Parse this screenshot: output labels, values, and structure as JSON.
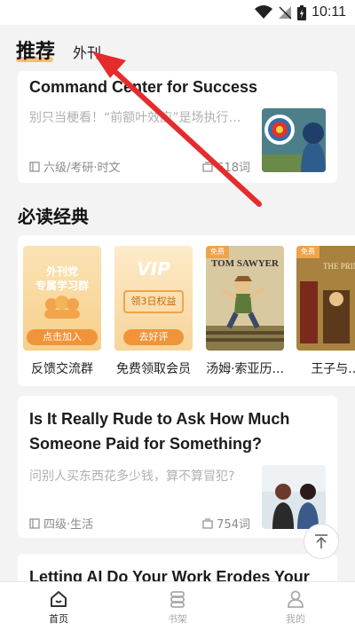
{
  "status_bar": {
    "time": "10:11"
  },
  "tabs": {
    "active": "推荐",
    "inactive": "外刊"
  },
  "article1": {
    "title": "Command Center for Success",
    "subtitle": "别只当梗看！“前额叶效应”是场执行…",
    "level": "六级/考研·时文",
    "words": "618词"
  },
  "section": {
    "title": "必读经典"
  },
  "classics": {
    "items": [
      {
        "label": "反馈交流群",
        "cover_line1": "外刊党",
        "cover_line2": "专属学习群",
        "cover_button": "点击加入"
      },
      {
        "label": "免费领取会员",
        "cover_vip": "VIP",
        "cover_line1": "领3日权益",
        "cover_button": "去好评"
      },
      {
        "label": "汤姆·索亚历...",
        "cover_title": "TOM SAWYER",
        "cover_tag": "免费"
      },
      {
        "label": "王子与...",
        "cover_title": "THE PRINCE",
        "cover_tag": "免费"
      }
    ]
  },
  "article2": {
    "title_line1": "Is It Really Rude to Ask How Much",
    "title_line2": "Someone Paid for Something?",
    "subtitle": "问别人买东西花多少钱，算不算冒犯?",
    "level": "四级·生活",
    "words": "754词"
  },
  "article3": {
    "title": "Letting AI Do Your Work Erodes Your"
  },
  "bottom_nav": {
    "items": [
      {
        "label": "首页",
        "active": true
      },
      {
        "label": "书架",
        "active": false
      },
      {
        "label": "我的",
        "active": false
      }
    ]
  },
  "colors": {
    "accent": "#f2c16e",
    "annotation": "#e52b2b",
    "orange": "#f0a44a"
  }
}
